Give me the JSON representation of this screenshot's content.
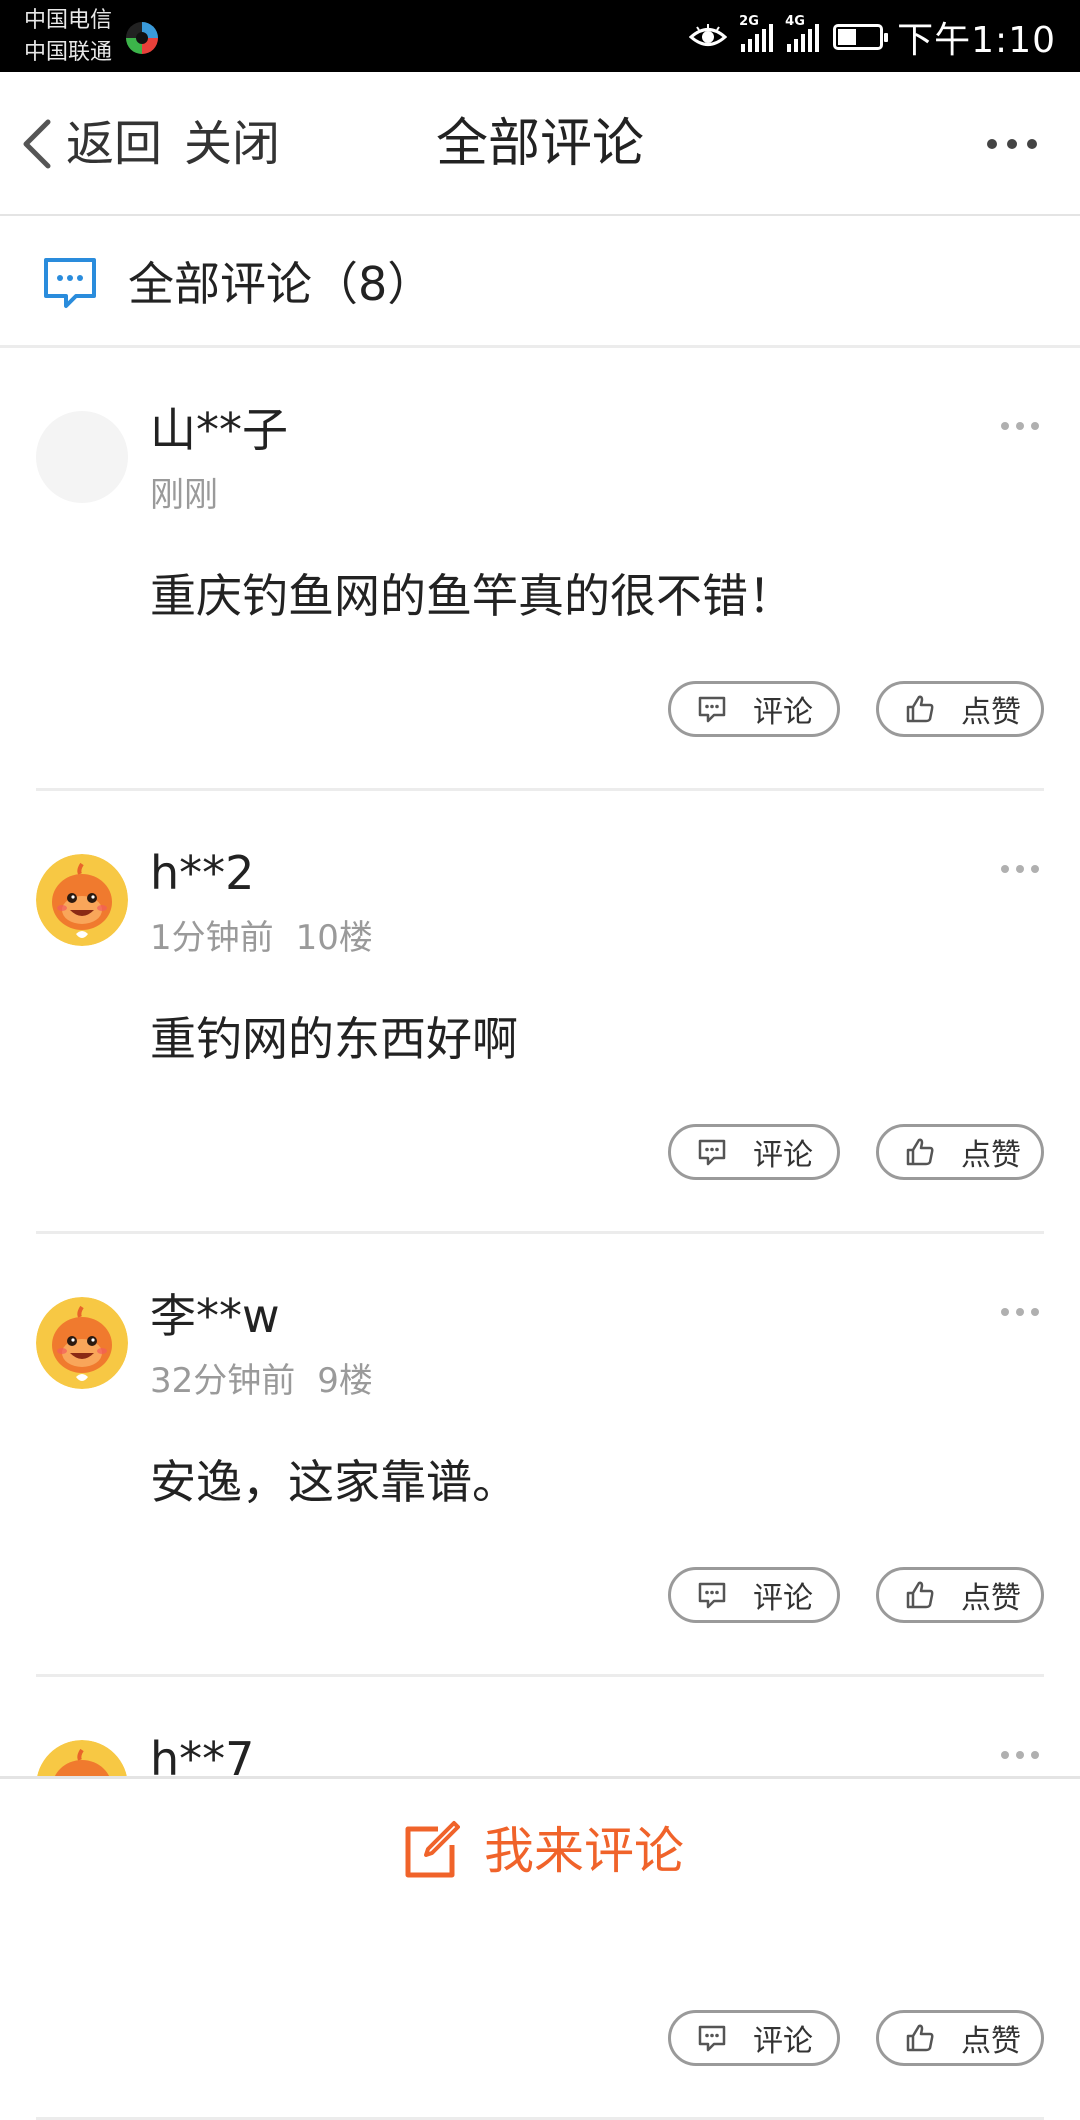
{
  "status_bar": {
    "carrier1": "中国电信",
    "carrier2": "中国联通",
    "net1": "2G",
    "net2": "4G",
    "time": "下午1:10",
    "battery_level": 0.45
  },
  "nav": {
    "back_label": "返回",
    "close_label": "关闭",
    "title": "全部评论"
  },
  "section": {
    "title": "全部评论（8）"
  },
  "comments": [
    {
      "user": "山**子",
      "time": "刚刚",
      "floor": "",
      "text": "重庆钓鱼网的鱼竿真的很不错！",
      "avatar": "blank"
    },
    {
      "user": "h**2",
      "time": "1分钟前",
      "floor": "10楼",
      "text": "重钓网的东西好啊",
      "avatar": "mascot"
    },
    {
      "user": "李**w",
      "time": "32分钟前",
      "floor": "9楼",
      "text": "安逸，这家靠谱。",
      "avatar": "mascot"
    },
    {
      "user": "h**7",
      "time": "",
      "floor": "",
      "text": "",
      "avatar": "mascot"
    }
  ],
  "actions": {
    "reply_label": "评论",
    "like_label": "点赞"
  },
  "bottom": {
    "cta_label": "我来评论"
  },
  "colors": {
    "accent": "#f0632a",
    "icon_blue": "#2a8cdc",
    "meta_gray": "#9a9a9a",
    "divider": "#ececec"
  }
}
